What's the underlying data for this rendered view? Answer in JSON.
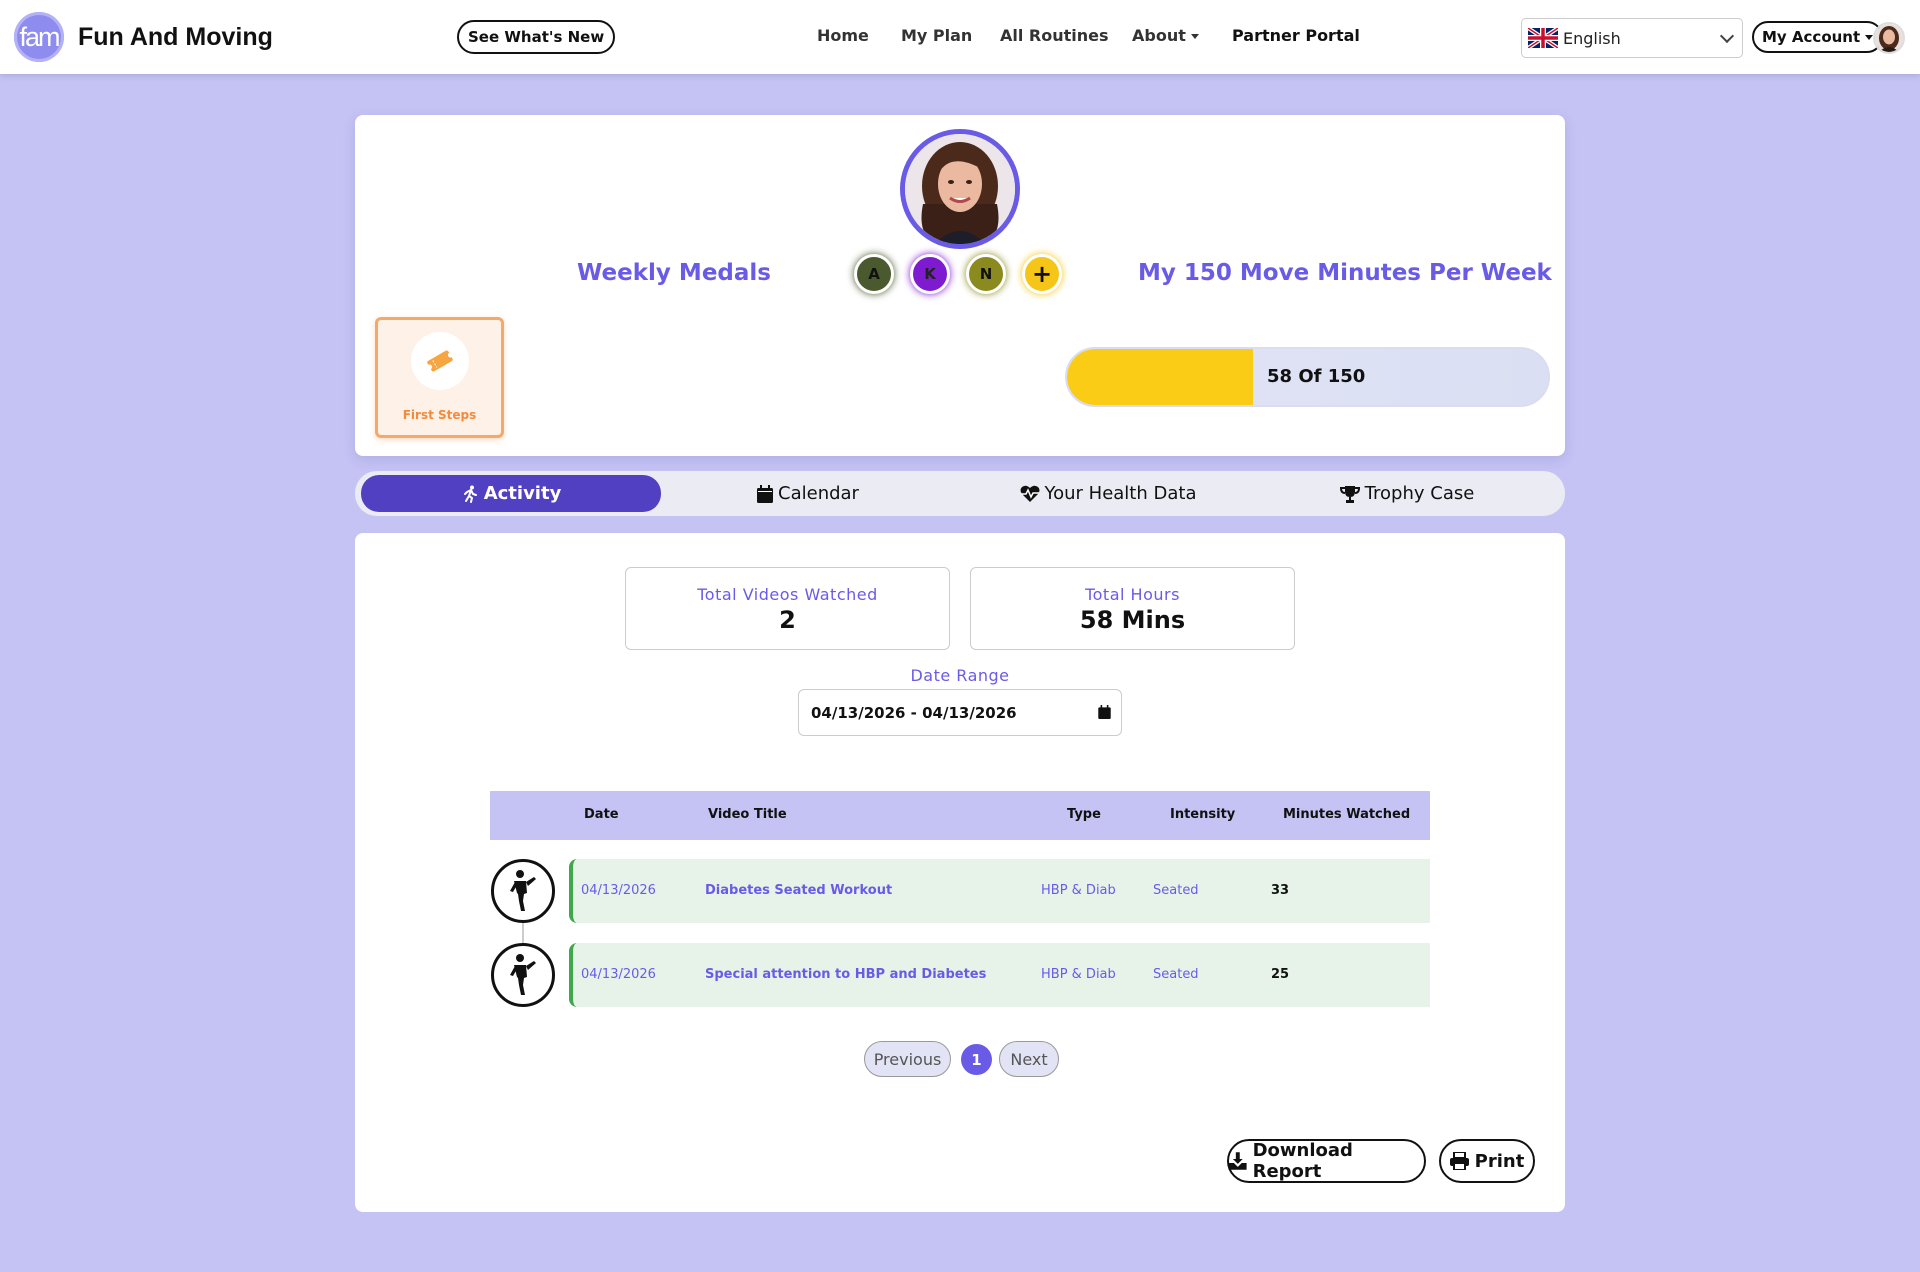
{
  "header": {
    "logo_text": "fam",
    "brand": "Fun And Moving",
    "whats_new": "See What's New",
    "nav": [
      {
        "label": "Home"
      },
      {
        "label": "My Plan"
      },
      {
        "label": "All Routines"
      },
      {
        "label": "About"
      },
      {
        "label": "Partner Portal"
      }
    ],
    "language": "English",
    "account": "My Account"
  },
  "profile": {
    "weekly_medals_title": "Weekly Medals",
    "move_minutes_title": "My 150 Move Minutes Per Week",
    "badges": [
      {
        "letter": "A",
        "color": "#4a5a2e"
      },
      {
        "letter": "K",
        "color": "#7e1bd1"
      },
      {
        "letter": "N",
        "color": "#8a8a1e"
      },
      {
        "letter": "+",
        "color": "#f5c518"
      }
    ],
    "medal": {
      "label": "First Steps",
      "icon": "ticket-icon"
    },
    "progress": {
      "current": 58,
      "total": 150,
      "text": "58 Of 150"
    }
  },
  "tabs": [
    {
      "label": "Activity",
      "icon": "running-icon",
      "active": true
    },
    {
      "label": "Calendar",
      "icon": "calendar-icon",
      "active": false
    },
    {
      "label": "Your Health Data",
      "icon": "heartbeat-icon",
      "active": false
    },
    {
      "label": "Trophy Case",
      "icon": "trophy-icon",
      "active": false
    }
  ],
  "activity": {
    "stats": [
      {
        "label": "Total Videos Watched",
        "value": "2"
      },
      {
        "label": "Total Hours",
        "value": "58 Mins"
      }
    ],
    "date_range_label": "Date Range",
    "date_range_value": "04/13/2026 - 04/13/2026",
    "columns": [
      "Date",
      "Video Title",
      "Type",
      "Intensity",
      "Minutes Watched"
    ],
    "rows": [
      {
        "date": "04/13/2026",
        "title": "Diabetes Seated Workout",
        "type": "HBP & Diab",
        "intensity": "Seated",
        "minutes": "33"
      },
      {
        "date": "04/13/2026",
        "title": "Special attention to HBP and Diabetes",
        "type": "HBP & Diab",
        "intensity": "Seated",
        "minutes": "25"
      }
    ],
    "pagination": {
      "previous": "Previous",
      "page": "1",
      "next": "Next"
    },
    "download_label": "Download Report",
    "print_label": "Print"
  }
}
